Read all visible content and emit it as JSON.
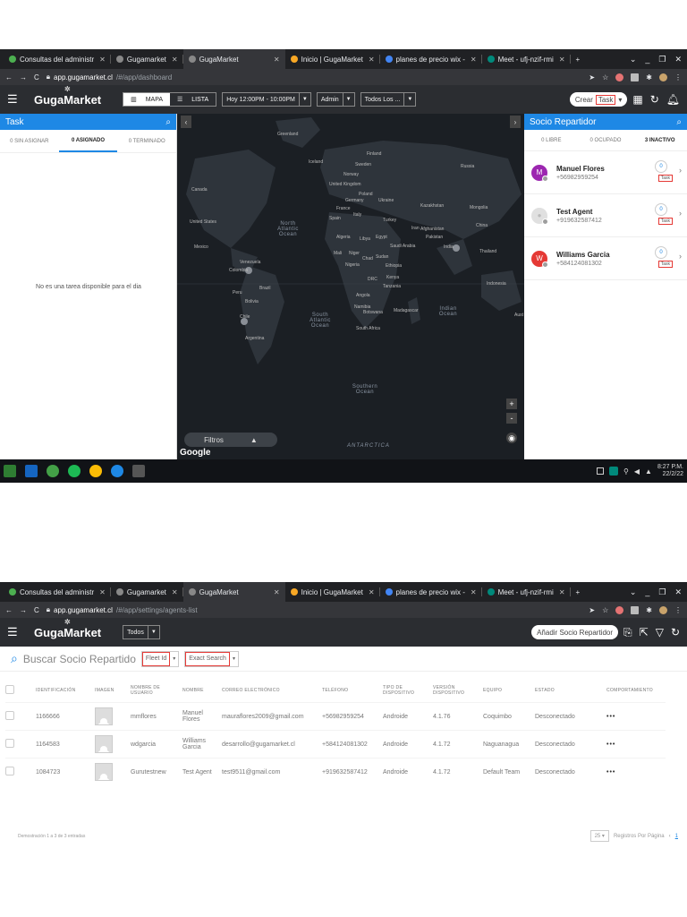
{
  "browser": {
    "tabs": [
      {
        "label": "Consultas del administr",
        "icon_color": "#4caf50"
      },
      {
        "label": "Gugamarket",
        "icon_color": "#888888"
      },
      {
        "label": "GugaMarket",
        "icon_color": "#888888"
      },
      {
        "label": "Inicio | GugaMarket",
        "icon_color": "#f9a825"
      },
      {
        "label": "planes de precio wix - ",
        "icon_color": "#4285f4"
      },
      {
        "label": "Meet - ufj-nzif-rmi",
        "icon_color": "#00897b"
      }
    ],
    "new_tab": "+",
    "url1_host": "app.gugamarket.cl",
    "url1_path": "/#/app/dashboard",
    "url2_host": "app.gugamarket.cl",
    "url2_path": "/#/app/settings/agents-list"
  },
  "app": {
    "logo": "GugaMarket",
    "view_toggle": {
      "map": "MAPA",
      "list": "LISTA"
    },
    "date_range": "Hoy 12:00PM - 10:00PM",
    "admin_select": "Admin",
    "teams_select": "Todos Los ...",
    "create_prefix": "Crear",
    "create_highlight": "Task"
  },
  "task_panel": {
    "title": "Task",
    "tabs": [
      "0 SIN ASIGNAR",
      "0 ASIGNADO",
      "0 TERMINADO"
    ],
    "empty_message": "No es una tarea disponible para el dia"
  },
  "map": {
    "oceans": {
      "north_atlantic": "North Atlantic Ocean",
      "south_atlantic": "South Atlantic Ocean",
      "indian": "Indian Ocean",
      "southern": "Southern Ocean"
    },
    "antarctica": "ANTARCTICA",
    "labels": [
      "Greenland",
      "Iceland",
      "Sweden",
      "Finland",
      "Norway",
      "Russia",
      "United Kingdom",
      "Poland",
      "Germany",
      "Ukraine",
      "Kazakhstan",
      "Mongolia",
      "France",
      "Italy",
      "Spain",
      "Turkey",
      "Iran",
      "China",
      "Canada",
      "United States",
      "Mexico",
      "Algeria",
      "Libya",
      "Egypt",
      "Saudi Arabia",
      "Afghanistan",
      "Pakistan",
      "India",
      "Mali",
      "Niger",
      "Chad",
      "Sudan",
      "Thailand",
      "Venezuela",
      "Colombia",
      "Nigeria",
      "Ethiopia",
      "Peru",
      "Brazil",
      "DRC",
      "Kenya",
      "Tanzania",
      "Indonesia",
      "Bolivia",
      "Angola",
      "Namibia",
      "Botswana",
      "Madagascar",
      "Chile",
      "South Africa",
      "Argentina",
      "Aust"
    ],
    "filters_label": "Filtros",
    "google": "Google",
    "zoom_in": "+",
    "zoom_out": "-"
  },
  "agents_panel": {
    "title": "Socio Repartidor",
    "tabs": [
      "0 LIBRE",
      "0 OCUPADO",
      "3 INACTIVO"
    ],
    "agents": [
      {
        "initial": "M",
        "name": "Manuel Flores",
        "phone": "+56982959254",
        "count": "0",
        "task": "Task",
        "color": "#9c27b0"
      },
      {
        "initial": "",
        "name": "Test Agent",
        "phone": "+919632587412",
        "count": "0",
        "task": "Task",
        "color": "#e0e0e0"
      },
      {
        "initial": "W",
        "name": "Williams Garcia",
        "phone": "+584124081302",
        "count": "0",
        "task": "Task",
        "color": "#e53935"
      }
    ]
  },
  "taskbar": {
    "time": "8:27 P.M.",
    "date": "22/2/22"
  },
  "agents_list": {
    "all_select": "Todos",
    "add_button": "Añadir Socio Repartidor",
    "search_placeholder": "Buscar Socio Repartido",
    "filter_field": "Fleet Id",
    "filter_mode": "Exact Search",
    "columns": [
      "IDENTIFICACIÓN",
      "IMAGEN",
      "NOMBRE DE USUARIO",
      "NOMBRE",
      "CORREO ELECTRÓNICO",
      "TELÉFONO",
      "TIPO DE DISPOSITIVO",
      "VERSIÓN DISPOSITIVO",
      "EQUIPO",
      "ESTADO",
      "COMPORTAMIENTO"
    ],
    "rows": [
      {
        "id": "1166666",
        "username": "mmflores",
        "name": "Manuel Flores",
        "email": "mauraflores2009@gmail.com",
        "phone": "+56982959254",
        "device": "Androide",
        "version": "4.1.76",
        "team": "Coquimbo",
        "status": "Desconectado",
        "actions": "•••"
      },
      {
        "id": "1164583",
        "username": "wdgarcia",
        "name": "Williams Garcia",
        "email": "desarrollo@gugamarket.cl",
        "phone": "+584124081302",
        "device": "Androide",
        "version": "4.1.72",
        "team": "Naguanagua",
        "status": "Desconectado",
        "actions": "•••"
      },
      {
        "id": "1084723",
        "username": "Gurutestnew",
        "name": "Test Agent",
        "email": "test9511@gmail.com",
        "phone": "+919632587412",
        "device": "Androide",
        "version": "4.1.72",
        "team": "Default Team",
        "status": "Desconectado",
        "actions": "•••"
      }
    ],
    "footer_text": "Demostración 1 a 3 de 3 entradas",
    "per_page": "25",
    "per_page_label": "Registros Por Página",
    "page": "1"
  },
  "colors": {
    "accent": "#1e88e5",
    "highlight": "#e53935",
    "dark_bar": "#2b2d31"
  }
}
